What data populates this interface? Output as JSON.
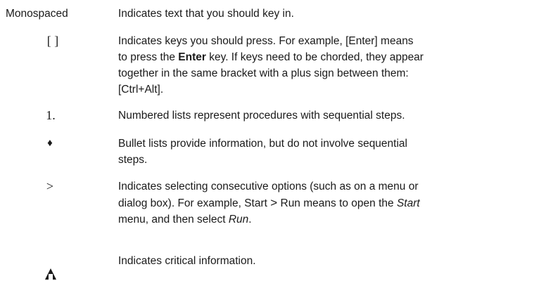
{
  "conventions": [
    {
      "symbol": "Monospaced",
      "lines": [
        "Indicates text that you should key in."
      ]
    },
    {
      "symbol": "[ ]",
      "line1_prefix": "Indicates keys you should press. For example, [Enter] means",
      "line2_prefix": "to press the ",
      "line2_bold": "Enter",
      "line2_suffix": " key. If keys need to be chorded, they appear",
      "line3": "together in the same bracket with a plus sign between them:",
      "line4": "[Ctrl+Alt]."
    },
    {
      "symbol": "1.",
      "lines": [
        "Numbered lists represent procedures with sequential steps."
      ]
    },
    {
      "symbol": "♦",
      "lines": [
        "Bullet lists provide information, but do not involve sequential",
        "steps."
      ]
    },
    {
      "symbol": ">",
      "line1": "Indicates selecting consecutive options (such as on a menu or",
      "line2_prefix": "dialog box). For example, Start ",
      "line2_sym": ">",
      "line2_mid": " Run means to open the ",
      "line2_italic": "Start",
      "line3_prefix": "menu, and then select ",
      "line3_italic": "Run",
      "line3_suffix": "."
    },
    {
      "symbol_icon": "caution-triangle-icon",
      "lines": [
        "Indicates critical information."
      ]
    }
  ]
}
